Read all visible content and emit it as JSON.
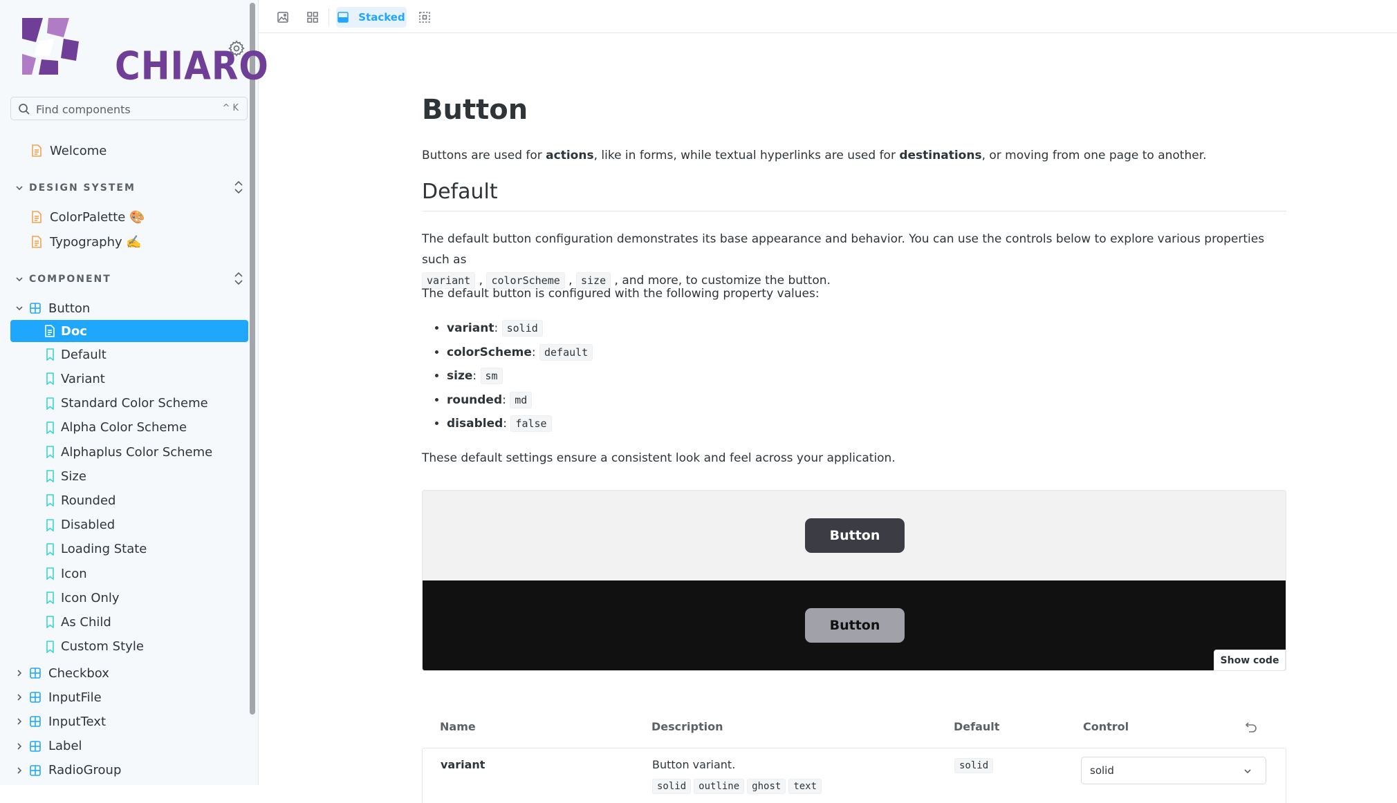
{
  "sidebar": {
    "logo_text": "CHIARO",
    "search": {
      "placeholder": "Find components",
      "shortcut": "^ K"
    },
    "welcome": "Welcome",
    "groups": [
      {
        "title": "DESIGN SYSTEM",
        "items": [
          "ColorPalette 🎨",
          "Typography ✍️"
        ]
      },
      {
        "title": "COMPONENT"
      }
    ],
    "button_component": {
      "label": "Button",
      "stories": [
        "Doc",
        "Default",
        "Variant",
        "Standard Color Scheme",
        "Alpha Color Scheme",
        "Alphaplus Color Scheme",
        "Size",
        "Rounded",
        "Disabled",
        "Loading State",
        "Icon",
        "Icon Only",
        "As Child",
        "Custom Style"
      ],
      "active_story": "Doc"
    },
    "other_components": [
      "Checkbox",
      "InputFile",
      "InputText",
      "Label",
      "RadioGroup"
    ]
  },
  "toolbar": {
    "stacked_label": "Stacked"
  },
  "doc": {
    "title": "Button",
    "intro": {
      "p1": "Buttons are used for ",
      "b1": "actions",
      "p2": ", like in forms, while textual hyperlinks are used for ",
      "b2": "destinations",
      "p3": ", or moving from one page to another."
    },
    "section_title": "Default",
    "desc": {
      "p1": "The default button configuration demonstrates its base appearance and behavior. You can use the controls below to explore various properties such as",
      "c1": "variant",
      "c2": "colorScheme",
      "c3": "size",
      "p2": ", and more, to customize the button."
    },
    "configured_text": "The default button is configured with the following property values:",
    "props": [
      {
        "name": "variant",
        "value": "solid"
      },
      {
        "name": "colorScheme",
        "value": "default"
      },
      {
        "name": "size",
        "value": "sm"
      },
      {
        "name": "rounded",
        "value": "md"
      },
      {
        "name": "disabled",
        "value": "false"
      }
    ],
    "closing": "These default settings ensure a consistent look and feel across your application.",
    "preview": {
      "button_label": "Button",
      "show_code": "Show code"
    },
    "table": {
      "headers": {
        "name": "Name",
        "description": "Description",
        "default": "Default",
        "control": "Control"
      },
      "row": {
        "name": "variant",
        "description": "Button variant.",
        "options": [
          "solid",
          "outline",
          "ghost",
          "text"
        ],
        "default": "solid",
        "control_value": "solid"
      }
    }
  },
  "colors": {
    "accent": "#1ea7fd",
    "logo": "#6f3f98",
    "doc_icon": "#f7a24a",
    "story_icon": "#37d5d3",
    "component_icon": "#1ea7fd"
  }
}
